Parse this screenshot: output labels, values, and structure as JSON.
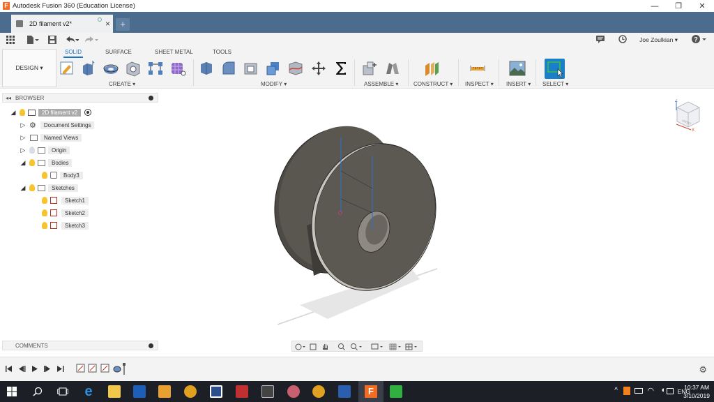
{
  "window": {
    "title": "Autodesk Fusion 360 (Education License)",
    "app_logo_letter": "F"
  },
  "tabs": {
    "doc_title": "2D filament v2*",
    "new_tab": "+"
  },
  "quickbar": {
    "user_name": "Joe Zoulkian ▾"
  },
  "ribbon": {
    "workspace": "DESIGN ▾",
    "tabs": [
      "SOLID",
      "SURFACE",
      "SHEET METAL",
      "TOOLS"
    ],
    "active_tab": "SOLID",
    "groups": [
      "CREATE ▾",
      "MODIFY ▾",
      "ASSEMBLE ▾",
      "CONSTRUCT ▾",
      "INSPECT ▾",
      "INSERT ▾",
      "SELECT ▾"
    ]
  },
  "browser": {
    "title": "BROWSER",
    "root": "2D filament v2",
    "items": [
      "Document Settings",
      "Named Views",
      "Origin",
      "Bodies",
      "Body3",
      "Sketches",
      "Sketch1",
      "Sketch2",
      "Sketch3"
    ]
  },
  "comments": {
    "title": "COMMENTS"
  },
  "viewcube": {
    "face_label": "FRONT",
    "axis_x": "X",
    "axis_z": "Z"
  },
  "taskbar": {
    "lang": "ENG",
    "time": "10:37 AM",
    "date": "3/10/2019"
  },
  "colors": {
    "tab_strip": "#4b6c8c",
    "accent": "#1a74c4",
    "taskbar": "#1c1f26",
    "model": "#5a5750"
  }
}
